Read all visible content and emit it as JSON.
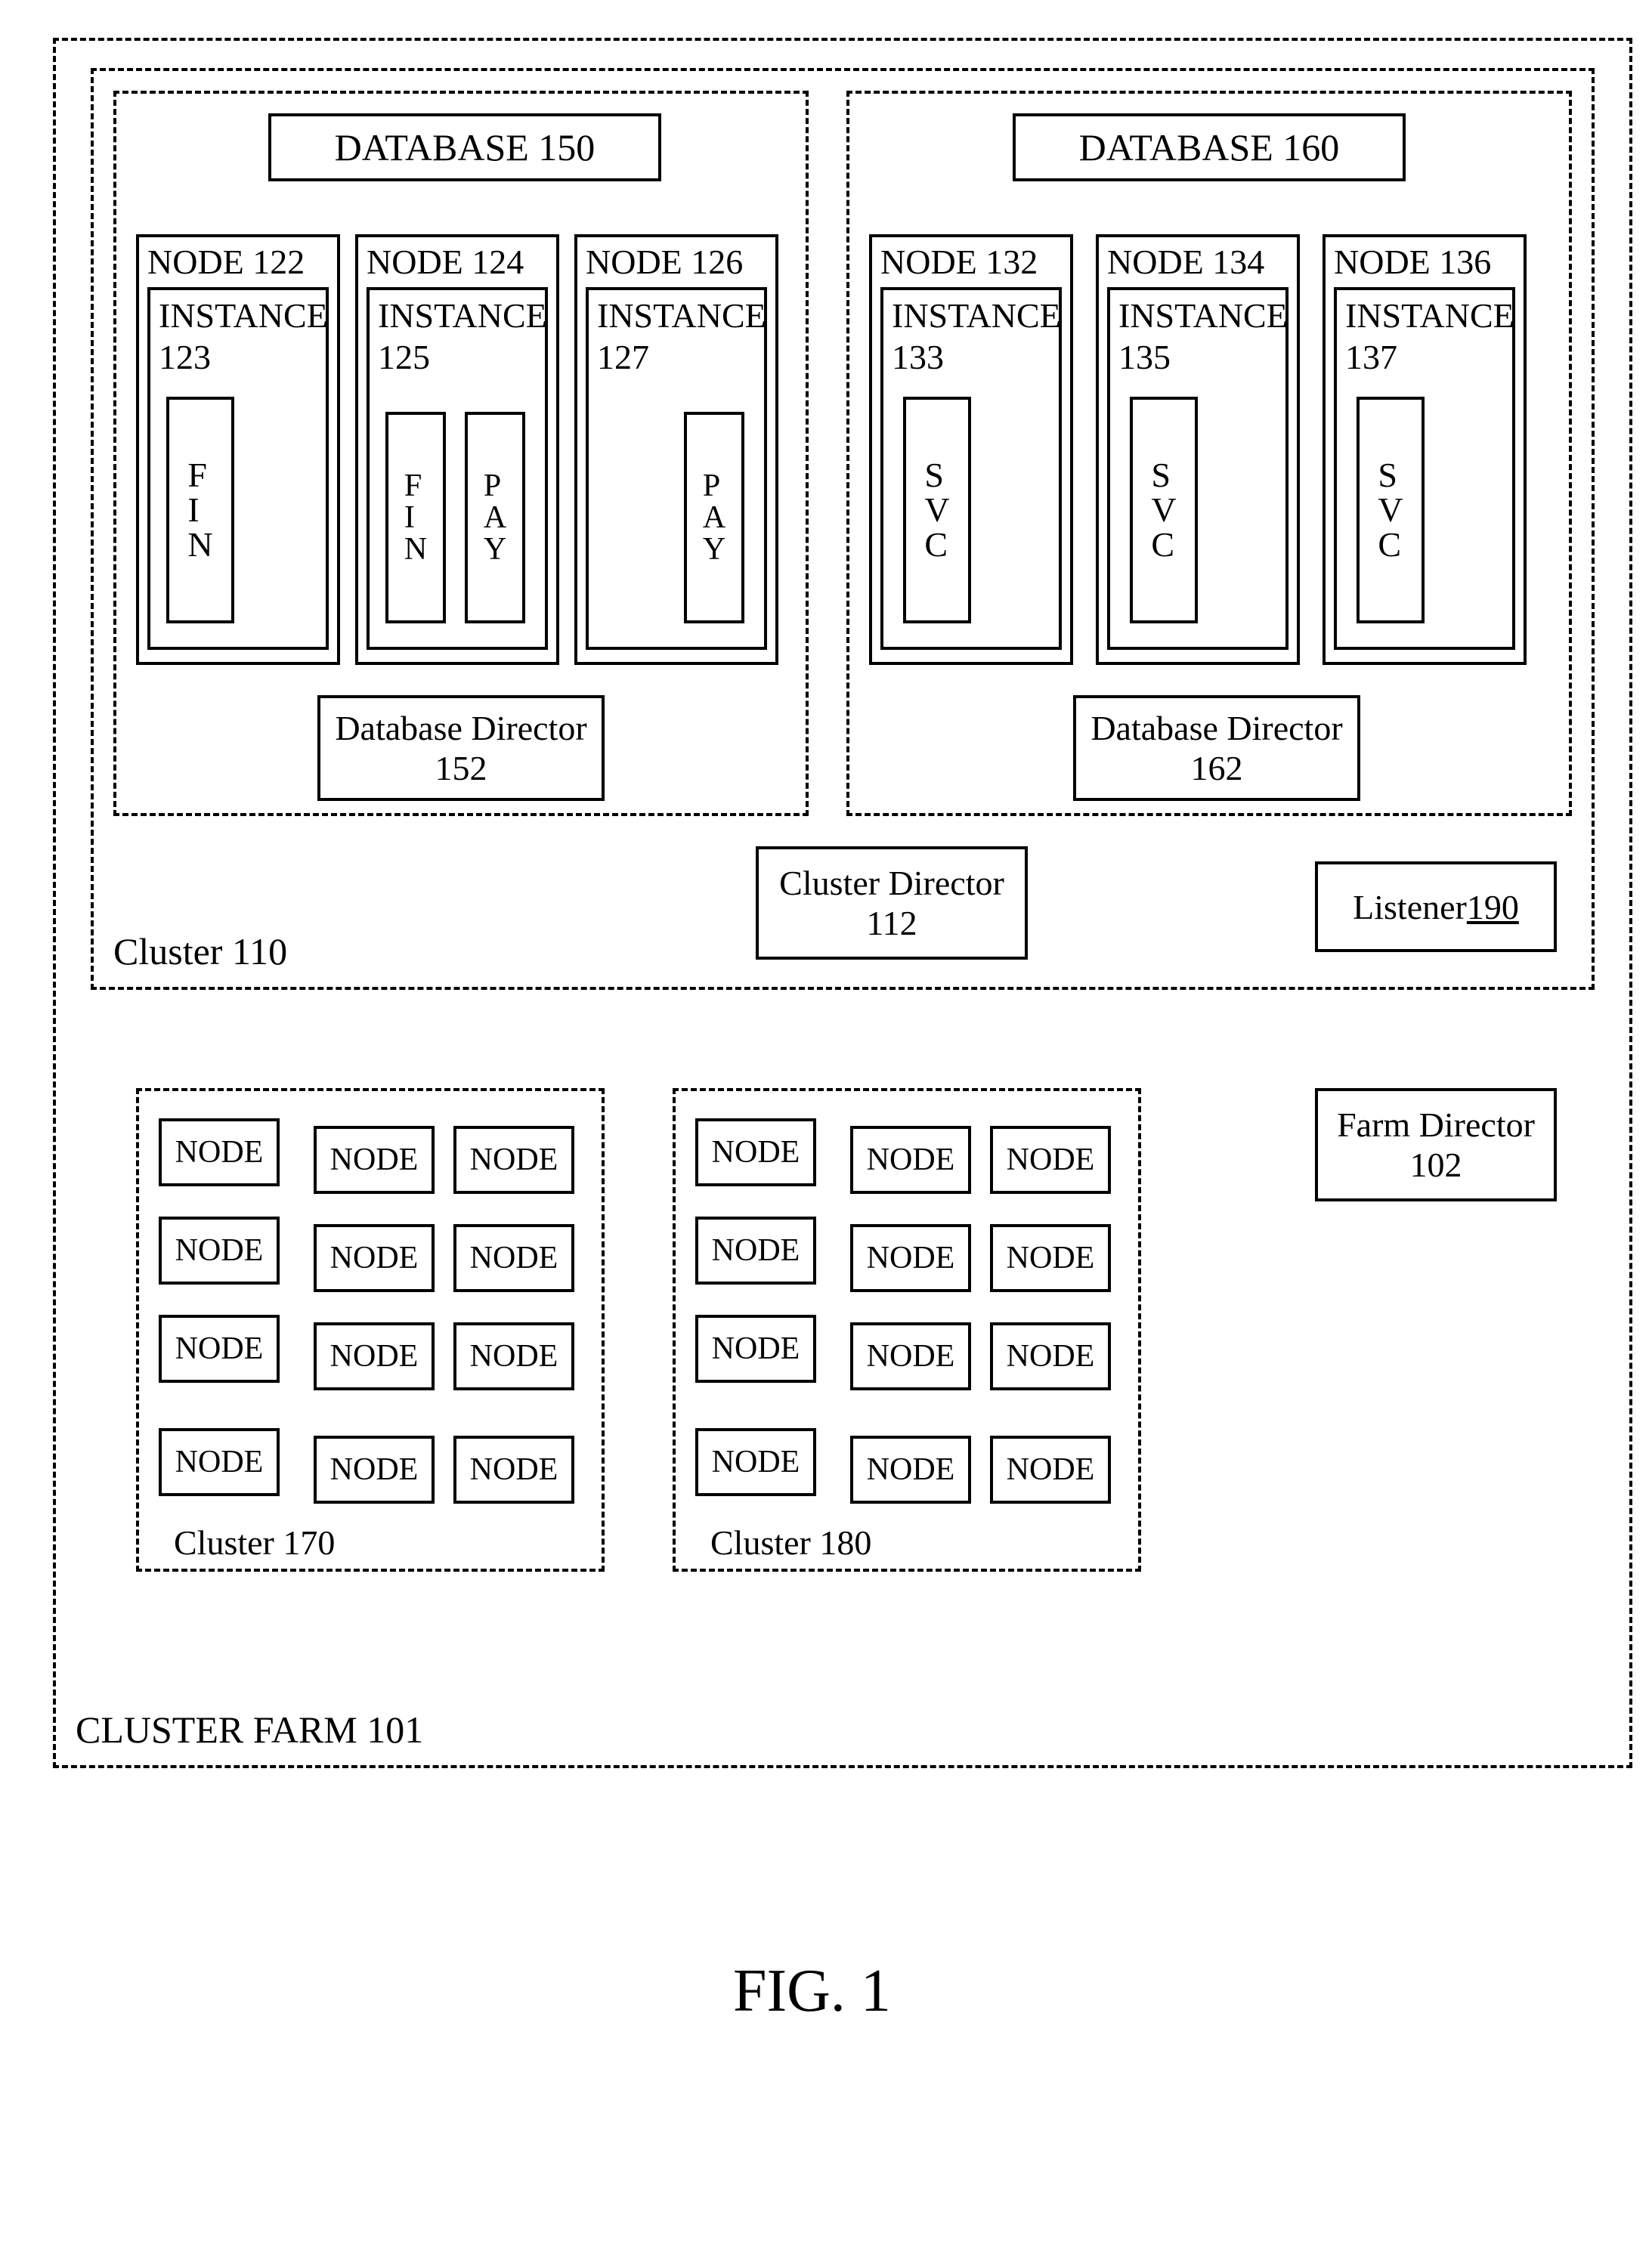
{
  "figure_label": "FIG. 1",
  "farm": {
    "label": "CLUSTER FARM 101"
  },
  "cluster110": {
    "label": "Cluster 110",
    "database150": {
      "label": "DATABASE  150",
      "director": "Database Director 152",
      "node122": {
        "label": "NODE 122",
        "instance": "INSTANCE 123",
        "svc1": "F\nI\nN"
      },
      "node124": {
        "label": "NODE 124",
        "instance": "INSTANCE 125",
        "svc1": "F\nI\nN",
        "svc2": "P\nA\nY"
      },
      "node126": {
        "label": "NODE 126",
        "instance": "INSTANCE 127",
        "svc2": "P\nA\nY"
      }
    },
    "database160": {
      "label": "DATABASE  160",
      "director": "Database Director 162",
      "node132": {
        "label": "NODE 132",
        "instance": "INSTANCE 133",
        "svc1": "S\nV\nC"
      },
      "node134": {
        "label": "NODE 134",
        "instance": "INSTANCE 135",
        "svc1": "S\nV\nC"
      },
      "node136": {
        "label": "NODE 136",
        "instance": "INSTANCE 137",
        "svc1": "S\nV\nC"
      }
    },
    "cluster_director": "Cluster Director 112",
    "listener": "Listener 190",
    "listener_text": "Listener ",
    "listener_num": "190"
  },
  "farm_director": "Farm Director 102",
  "cluster170": {
    "label": "Cluster 170",
    "node": "NODE"
  },
  "cluster180": {
    "label": "Cluster 180",
    "node": "NODE"
  }
}
